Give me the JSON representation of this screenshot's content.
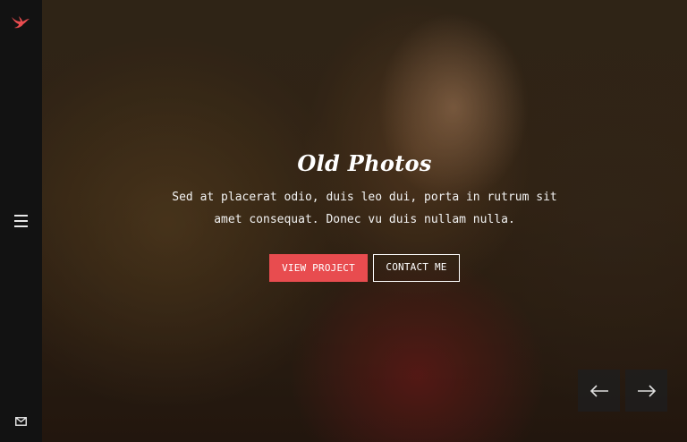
{
  "sidebar": {
    "logo_icon": "bird-logo",
    "menu_icon": "hamburger-menu-icon",
    "mail_icon": "envelope-icon",
    "accent_color": "#e84c4f"
  },
  "hero": {
    "title": "Old Photos",
    "subtitle": "Sed at placerat odio, duis leo dui, porta in rutrum sit amet consequat. Donec vu duis nullam nulla.",
    "primary_button": "VIEW PROJECT",
    "secondary_button": "CONTACT ME"
  },
  "slider": {
    "prev_icon": "arrow-left-icon",
    "next_icon": "arrow-right-icon"
  }
}
